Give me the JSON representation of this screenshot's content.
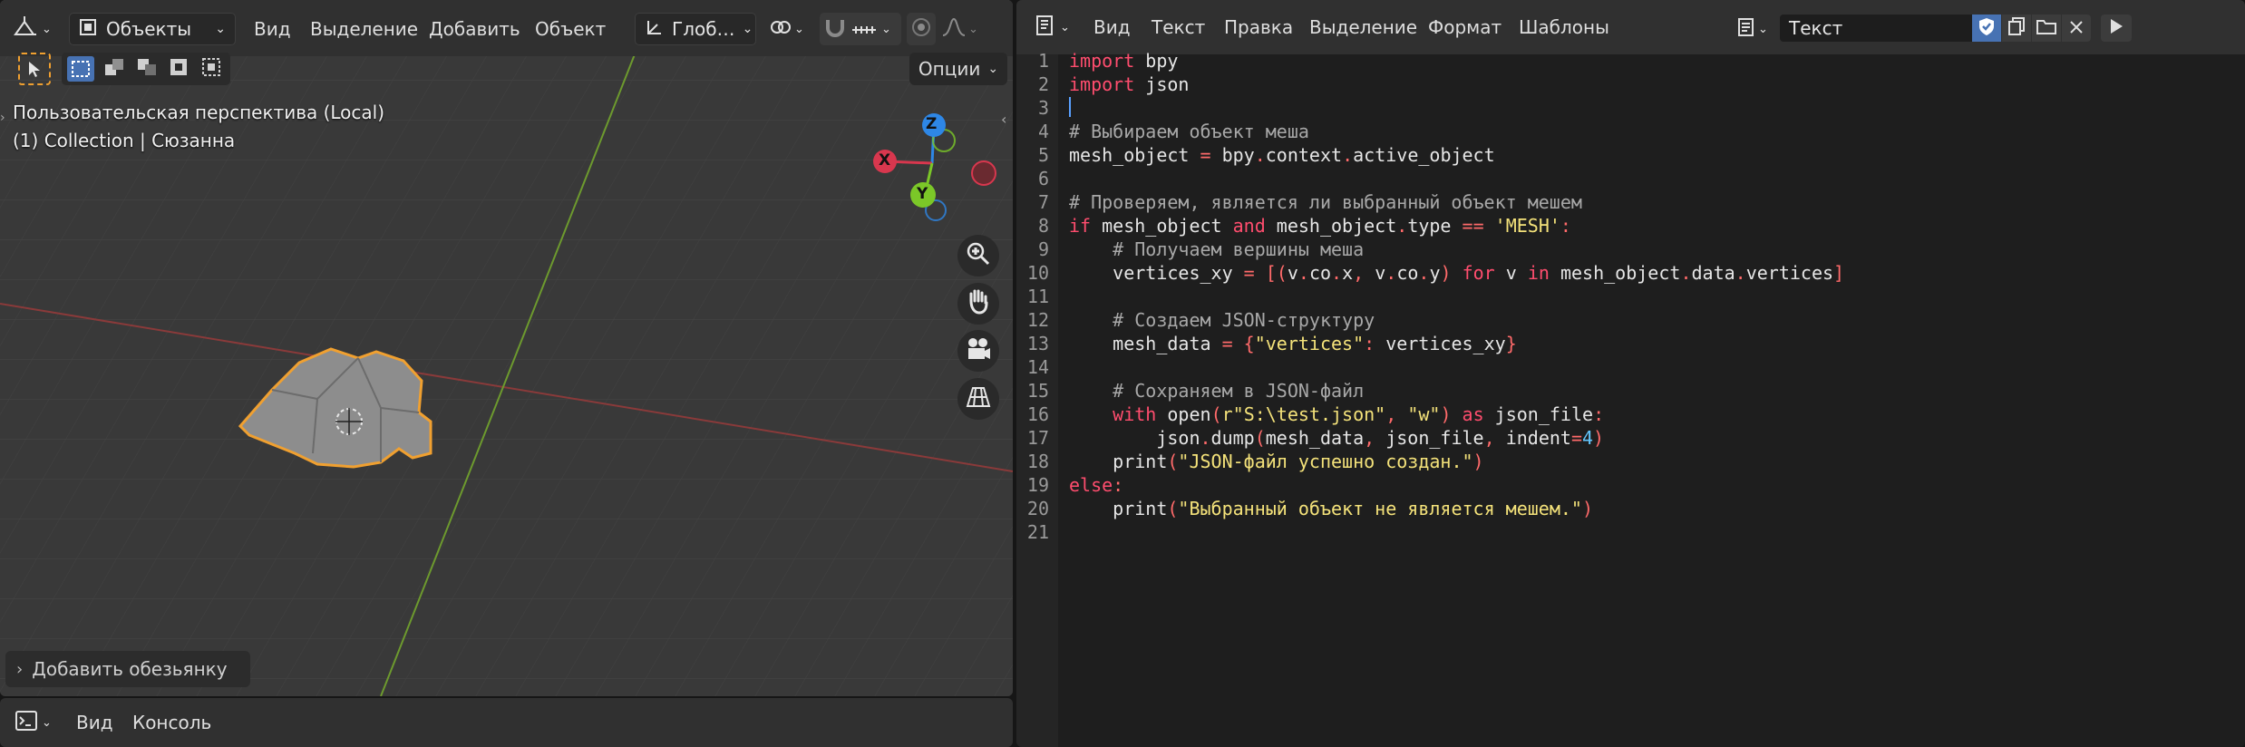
{
  "viewport": {
    "editor_type_icon": "view3d-icon",
    "mode_label": "Объекты",
    "menus": [
      "Вид",
      "Выделение",
      "Добавить",
      "Объект"
    ],
    "orientation_label": "Глоб…",
    "options_label": "Опции",
    "view_name": "Пользовательская перспектива (Local)",
    "collection_info": "(1) Collection | Сюзанна",
    "gizmo_axes": {
      "z": "Z",
      "x": "X",
      "y": "Y"
    },
    "last_operator": "Добавить обезьянку",
    "colors": {
      "x_axis": "#d8374e",
      "y_axis": "#7bc728",
      "z_axis": "#2e87e6",
      "selection": "#f0a030"
    }
  },
  "console": {
    "menus": [
      "Вид",
      "Консоль"
    ]
  },
  "text_editor": {
    "menus": [
      "Вид",
      "Текст",
      "Правка",
      "Выделение",
      "Формат",
      "Шаблоны"
    ],
    "datablock_name": "Текст",
    "line_numbers": [
      "1",
      "2",
      "3",
      "4",
      "5",
      "6",
      "7",
      "8",
      "9",
      "10",
      "11",
      "12",
      "13",
      "14",
      "15",
      "16",
      "17",
      "18",
      "19",
      "20",
      "21"
    ],
    "code_lines": [
      "import bpy",
      "import json",
      "",
      "# Выбираем объект меша",
      "mesh_object = bpy.context.active_object",
      "",
      "# Проверяем, является ли выбранный объект мешем",
      "if mesh_object and mesh_object.type == 'MESH':",
      "    # Получаем вершины меша",
      "    vertices_xy = [(v.co.x, v.co.y) for v in mesh_object.data.vertices]",
      "",
      "    # Создаем JSON-структуру",
      "    mesh_data = {\"vertices\": vertices_xy}",
      "",
      "    # Сохраняем в JSON-файл",
      "    with open(r\"S:\\test.json\", \"w\") as json_file:",
      "        json.dump(mesh_data, json_file, indent=4)",
      "    print(\"JSON-файл успешно создан.\")",
      "else:",
      "    print(\"Выбранный объект не является мешем.\")",
      ""
    ]
  }
}
